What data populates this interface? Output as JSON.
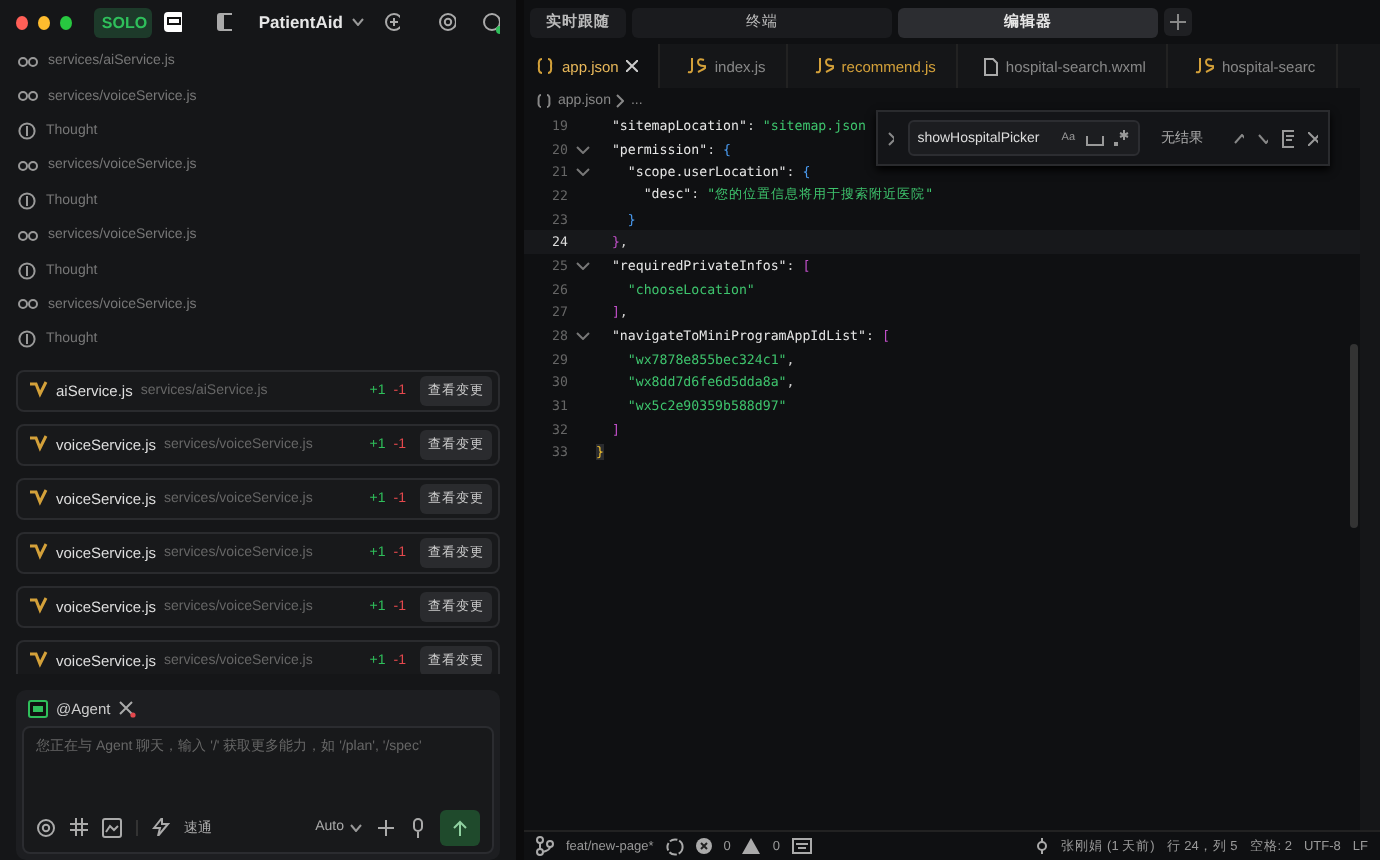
{
  "app_bar": {
    "mode": "SOLO",
    "project": "PatientAid"
  },
  "activity": [
    {
      "kind": "file",
      "text": "services/aiService.js"
    },
    {
      "kind": "file",
      "text": "services/voiceService.js"
    },
    {
      "kind": "thought",
      "text": "Thought"
    },
    {
      "kind": "file",
      "text": "services/voiceService.js"
    },
    {
      "kind": "thought",
      "text": "Thought"
    },
    {
      "kind": "file",
      "text": "services/voiceService.js"
    },
    {
      "kind": "thought",
      "text": "Thought"
    },
    {
      "kind": "file",
      "text": "services/voiceService.js"
    },
    {
      "kind": "thought",
      "text": "Thought"
    }
  ],
  "changes": [
    {
      "name": "aiService.js",
      "path": "services/aiService.js",
      "added": "+1",
      "removed": "-1",
      "button": "查看变更"
    },
    {
      "name": "voiceService.js",
      "path": "services/voiceService.js",
      "added": "+1",
      "removed": "-1",
      "button": "查看变更"
    },
    {
      "name": "voiceService.js",
      "path": "services/voiceService.js",
      "added": "+1",
      "removed": "-1",
      "button": "查看变更"
    },
    {
      "name": "voiceService.js",
      "path": "services/voiceService.js",
      "added": "+1",
      "removed": "-1",
      "button": "查看变更"
    },
    {
      "name": "voiceService.js",
      "path": "services/voiceService.js",
      "added": "+1",
      "removed": "-1",
      "button": "查看变更"
    },
    {
      "name": "voiceService.js",
      "path": "services/voiceService.js",
      "added": "+1",
      "removed": "-1",
      "button": "查看变更"
    }
  ],
  "chat": {
    "agent": "@Agent",
    "placeholder": "您正在与 Agent 聊天，输入 '/' 获取更多能力，如 '/plan', '/spec'",
    "speed": "速通",
    "model": "Auto"
  },
  "view_tabs": [
    {
      "label": "实时跟随",
      "selected": false
    },
    {
      "label": "终端",
      "selected": false
    },
    {
      "label": "编辑器",
      "selected": true
    }
  ],
  "editor_tabs": [
    {
      "kind": "json",
      "label": "app.json",
      "selected": true,
      "modified": false
    },
    {
      "kind": "js",
      "label": "index.js",
      "selected": false,
      "modified": false
    },
    {
      "kind": "js",
      "label": "recommend.js",
      "selected": false,
      "modified": true
    },
    {
      "kind": "file",
      "label": "hospital-search.wxml",
      "selected": false,
      "modified": false
    },
    {
      "kind": "js",
      "label": "hospital-searc",
      "selected": false,
      "modified": false
    }
  ],
  "breadcrumb": [
    "app.json",
    "..."
  ],
  "code": [
    {
      "no": "19",
      "fold": false,
      "current": false,
      "tokens": [
        {
          "kind": "key",
          "text": "  \"sitemapLocation\""
        },
        {
          "kind": "punc",
          "text": ": "
        },
        {
          "kind": "str",
          "text": "\"sitemap.json"
        }
      ]
    },
    {
      "no": "20",
      "fold": true,
      "current": false,
      "tokens": [
        {
          "kind": "key",
          "text": "  \"permission\""
        },
        {
          "kind": "punc",
          "text": ": "
        },
        {
          "kind": "brace",
          "text": "{"
        }
      ]
    },
    {
      "no": "21",
      "fold": true,
      "current": false,
      "tokens": [
        {
          "kind": "key",
          "text": "    \"scope.userLocation\""
        },
        {
          "kind": "punc",
          "text": ": "
        },
        {
          "kind": "brace",
          "text": "{"
        }
      ]
    },
    {
      "no": "22",
      "fold": false,
      "current": false,
      "tokens": [
        {
          "kind": "key",
          "text": "      \"desc\""
        },
        {
          "kind": "punc",
          "text": ": "
        },
        {
          "kind": "str",
          "text": "\"您的位置信息将用于搜索附近医院\""
        }
      ]
    },
    {
      "no": "23",
      "fold": false,
      "current": false,
      "tokens": [
        {
          "kind": "brace",
          "text": "    }"
        }
      ]
    },
    {
      "no": "24",
      "fold": false,
      "current": true,
      "tokens": [
        {
          "kind": "bracket",
          "text": "  }"
        },
        {
          "kind": "punc",
          "text": ","
        }
      ]
    },
    {
      "no": "25",
      "fold": true,
      "current": false,
      "tokens": [
        {
          "kind": "key",
          "text": "  \"requiredPrivateInfos\""
        },
        {
          "kind": "punc",
          "text": ": "
        },
        {
          "kind": "bracket",
          "text": "["
        }
      ]
    },
    {
      "no": "26",
      "fold": false,
      "current": false,
      "tokens": [
        {
          "kind": "str",
          "text": "    \"chooseLocation\""
        }
      ]
    },
    {
      "no": "27",
      "fold": false,
      "current": false,
      "tokens": [
        {
          "kind": "bracket",
          "text": "  ]"
        },
        {
          "kind": "punc",
          "text": ","
        }
      ]
    },
    {
      "no": "28",
      "fold": true,
      "current": false,
      "tokens": [
        {
          "kind": "key",
          "text": "  \"navigateToMiniProgramAppIdList\""
        },
        {
          "kind": "punc",
          "text": ": "
        },
        {
          "kind": "bracket",
          "text": "["
        }
      ]
    },
    {
      "no": "29",
      "fold": false,
      "current": false,
      "tokens": [
        {
          "kind": "str",
          "text": "    \"wx7878e855bec324c1\""
        },
        {
          "kind": "punc",
          "text": ","
        }
      ]
    },
    {
      "no": "30",
      "fold": false,
      "current": false,
      "tokens": [
        {
          "kind": "str",
          "text": "    \"wx8dd7d6fe6d5dda8a\""
        },
        {
          "kind": "punc",
          "text": ","
        }
      ]
    },
    {
      "no": "31",
      "fold": false,
      "current": false,
      "tokens": [
        {
          "kind": "str",
          "text": "    \"wx5c2e90359b588d97\""
        }
      ]
    },
    {
      "no": "32",
      "fold": false,
      "current": false,
      "tokens": [
        {
          "kind": "bracket",
          "text": "  ]"
        }
      ]
    },
    {
      "no": "33",
      "fold": false,
      "current": false,
      "tokens": [
        {
          "kind": "root",
          "text": "}"
        }
      ]
    }
  ],
  "find": {
    "query": "showHospitalPicker",
    "result": "无结果",
    "options": [
      "Aa"
    ]
  },
  "status_bar": {
    "branch": "feat/new-page*",
    "errors": "0",
    "warnings": "0",
    "author": "张刚娟 (1 天前)",
    "position": "行 24，列 5",
    "indent": "空格: 2",
    "encoding": "UTF-8",
    "eol": "LF"
  }
}
